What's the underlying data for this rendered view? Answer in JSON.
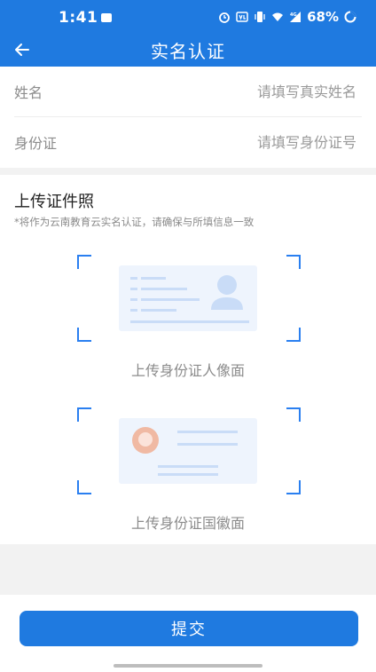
{
  "status_bar": {
    "time": "1:41",
    "battery": "68%",
    "network": "4G"
  },
  "nav": {
    "title": "实名认证",
    "back_icon": "arrow-left-icon"
  },
  "form": {
    "name": {
      "label": "姓名",
      "placeholder": "请填写真实姓名"
    },
    "id": {
      "label": "身份证",
      "placeholder": "请填写身份证号"
    }
  },
  "upload": {
    "title": "上传证件照",
    "note": "*将作为云南教育云实名认证，请确保与所填信息一致",
    "front_label": "上传身份证人像面",
    "back_label": "上传身份证国徽面"
  },
  "submit_label": "提交",
  "colors": {
    "primary": "#1f7ae0",
    "card_bg": "#eef4fd",
    "card_line": "#c9dcf7",
    "emblem": "#f0b9a3"
  }
}
